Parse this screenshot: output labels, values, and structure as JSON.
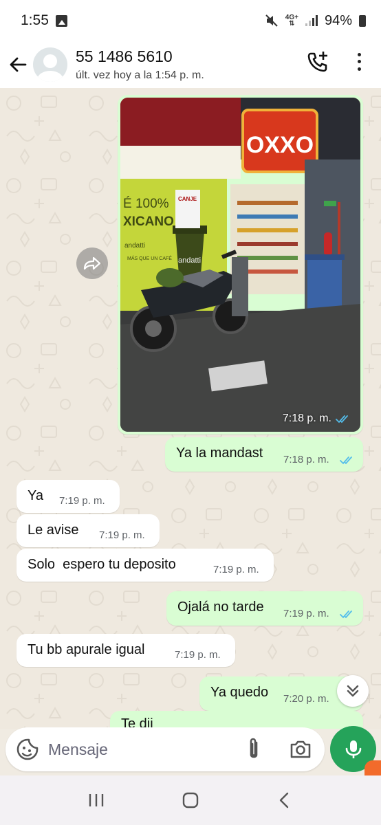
{
  "status_bar": {
    "time": "1:55",
    "network": "4G+",
    "battery": "94%"
  },
  "header": {
    "contact_name": "55 1486 5610",
    "last_seen": "últ. vez hoy a la 1:54 p. m."
  },
  "messages": [
    {
      "type": "image",
      "direction": "out",
      "time": "7:18 p. m.",
      "status": "read",
      "image_text": {
        "store_sign": "OXXO",
        "poster_line1": "É 100%",
        "poster_line2": "XICANO",
        "brand": "andatti",
        "slogan": "MÁS QUE UN CAFÉ",
        "notice": "CANJE"
      }
    },
    {
      "type": "text",
      "direction": "out",
      "text": "Ya la mandast",
      "time": "7:18 p. m.",
      "status": "read"
    },
    {
      "type": "text",
      "direction": "in",
      "text": "Ya",
      "time": "7:19 p. m."
    },
    {
      "type": "text",
      "direction": "in",
      "text": "Le avise",
      "time": "7:19 p. m."
    },
    {
      "type": "text",
      "direction": "in",
      "text": "Solo  espero tu deposito",
      "time": "7:19 p. m."
    },
    {
      "type": "text",
      "direction": "out",
      "text": "Ojalá no tarde",
      "time": "7:19 p. m.",
      "status": "read"
    },
    {
      "type": "text",
      "direction": "in",
      "text": "Tu bb apurale igual",
      "time": "7:19 p. m."
    },
    {
      "type": "text",
      "direction": "out",
      "text": "Ya quedo",
      "time": "7:20 p. m.",
      "status": "read"
    },
    {
      "type": "text",
      "direction": "out",
      "text": "Te dij",
      "time": "",
      "status": "",
      "partial": true
    }
  ],
  "composer": {
    "placeholder": "Mensaje"
  },
  "colors": {
    "outgoing_bubble": "#d9fdd3",
    "incoming_bubble": "#ffffff",
    "read_ticks": "#53bdeb",
    "mic_button": "#25a35a",
    "chat_background": "#efe9df"
  },
  "icons": {
    "back": "arrow-left-icon",
    "call_add": "call-add-icon",
    "menu": "more-vert-icon",
    "forward": "forward-icon",
    "scroll_down": "double-chevron-down-icon",
    "emoji": "sticker-emoji-icon",
    "attach": "paperclip-icon",
    "camera": "camera-icon",
    "mic": "microphone-icon"
  }
}
